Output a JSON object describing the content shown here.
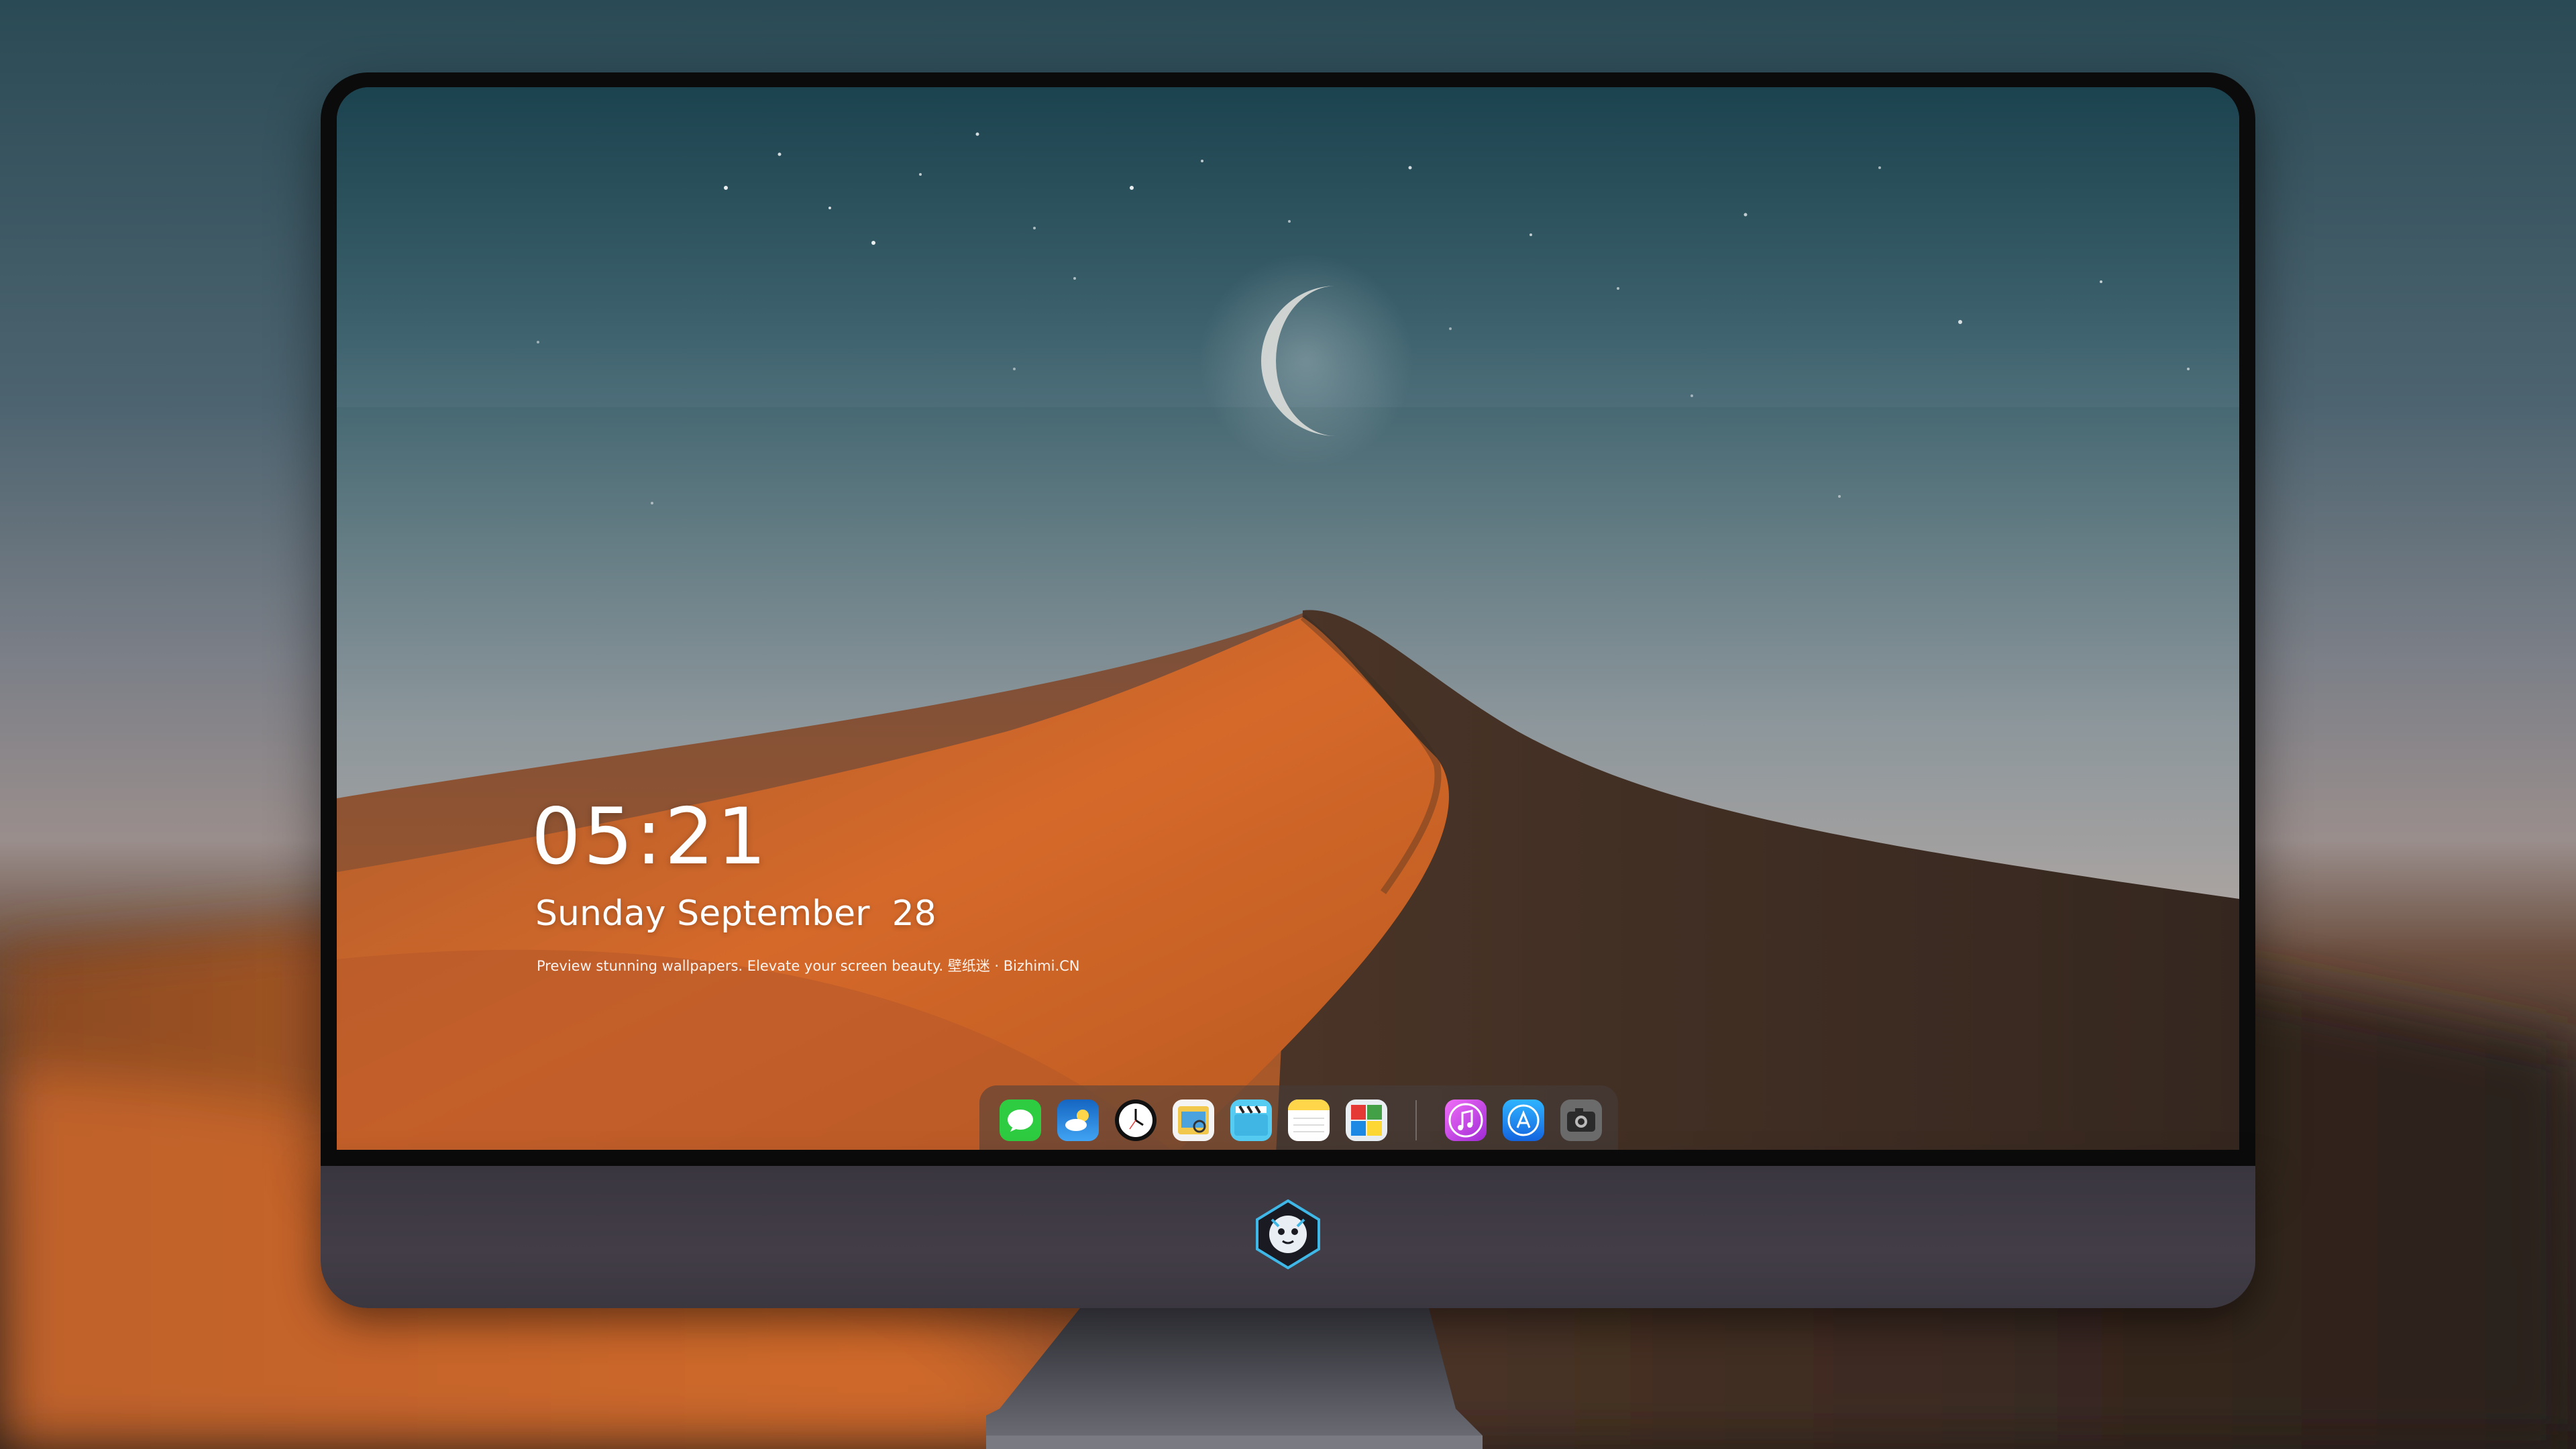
{
  "lock_screen": {
    "time": "05:21",
    "date": "Sunday September  28",
    "tagline": "Preview stunning wallpapers. Elevate your screen beauty. 壁纸迷 · Bizhimi.CN"
  },
  "dock": {
    "apps": [
      {
        "name": "messages-icon",
        "color": "#2ecc40"
      },
      {
        "name": "weather-icon",
        "color": "#1e88e5"
      },
      {
        "name": "clock-icon",
        "color": "#111111"
      },
      {
        "name": "preview-icon",
        "color": "#f2c94c"
      },
      {
        "name": "clips-icon",
        "color": "#56ccf2"
      },
      {
        "name": "notes-icon",
        "color": "#ffd54a"
      },
      {
        "name": "photo-booth-icon",
        "color": "#e9eef2"
      },
      {
        "name": "itunes-icon",
        "color": "#d94fe0"
      },
      {
        "name": "app-store-icon",
        "color": "#1e90ff"
      },
      {
        "name": "screenshot-icon",
        "color": "#555555"
      }
    ]
  },
  "monitor": {
    "logo": "mascot-logo-icon"
  },
  "colors": {
    "dune_light": "#d2692a",
    "dune_dark": "#3f2c22",
    "sky_top": "#1d4550",
    "sky_bottom": "#b3a7a2",
    "bezel": "#0b0b0c",
    "chin": "#3f3a44"
  }
}
